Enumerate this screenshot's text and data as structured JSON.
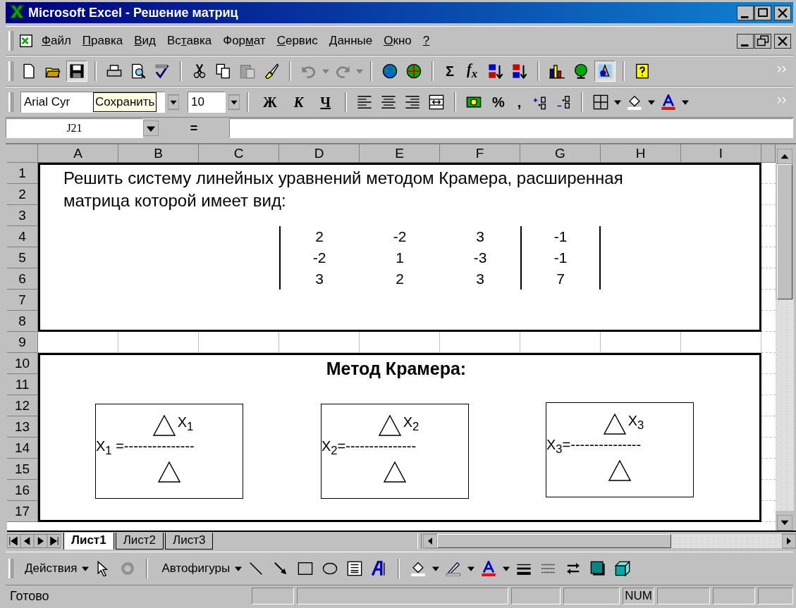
{
  "window": {
    "title": "Microsoft Excel - Решение матриц"
  },
  "menu": [
    {
      "key": "Ф",
      "post": "айл"
    },
    {
      "key": "П",
      "post": "равка"
    },
    {
      "key": "В",
      "post": "ид"
    },
    {
      "pre": "Вс",
      "key": "т",
      "post": "авка"
    },
    {
      "pre": "Фор",
      "key": "м",
      "post": "ат"
    },
    {
      "key": "С",
      "post": "ервис"
    },
    {
      "key": "Д",
      "post": "анные"
    },
    {
      "key": "О",
      "post": "кно"
    },
    {
      "key": "?"
    }
  ],
  "standard_toolbar": {
    "sum": "Σ",
    "function": "f$_{x}$"
  },
  "formatting_toolbar": {
    "font": "Arial Cyr",
    "tooltip": "Сохранить",
    "size": "10",
    "style_buttons": [
      "Ж",
      "К",
      "Ч"
    ],
    "percent": "%",
    "comma": ","
  },
  "formula_bar": {
    "name_box": "J21",
    "equals": "="
  },
  "columns": [
    "A",
    "B",
    "C",
    "D",
    "E",
    "F",
    "G",
    "H",
    "I"
  ],
  "rows": [
    "1",
    "2",
    "3",
    "4",
    "5",
    "6",
    "7",
    "8",
    "9",
    "10",
    "11",
    "12",
    "13",
    "14",
    "15",
    "16",
    "17"
  ],
  "sheet": {
    "task": "Решить систему линейных уравнений методом Крамера, расширенная\nматрица которой имеет вид:",
    "matrix": [
      [
        "2",
        "-2",
        "3",
        "-1"
      ],
      [
        "-2",
        "1",
        "-3",
        "-1"
      ],
      [
        "3",
        "2",
        "3",
        "7"
      ]
    ],
    "heading": "Метод Крамера:",
    "formulas": [
      {
        "top": "X$_{1}$",
        "lhs": "X$_{1}$ =---------------"
      },
      {
        "top": "X$_{2}$",
        "lhs": "X$_{2}$=---------------"
      },
      {
        "top": "X$_{3}$",
        "lhs": "X$_{3}$=---------------"
      }
    ]
  },
  "sheet_tabs": [
    {
      "label": "Лист1",
      "selected": true
    },
    {
      "label": "Лист2",
      "selected": false
    },
    {
      "label": "Лист3",
      "selected": false
    }
  ],
  "drawing_toolbar": {
    "actions": "Действия",
    "autoshapes": "Автофигуры"
  },
  "status_bar": {
    "text": "Готово",
    "indicators": [
      "NUM"
    ]
  }
}
